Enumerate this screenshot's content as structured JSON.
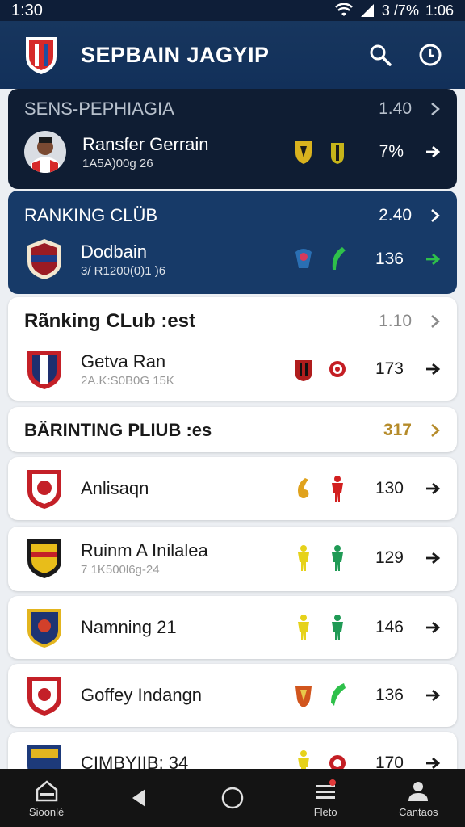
{
  "status_bar": {
    "time": "1:30",
    "battery": "3 /7%",
    "clock": "1:06"
  },
  "app_bar": {
    "title": "SEPBAIN JAGYIP"
  },
  "sections": [
    {
      "title": "SENS-PEPHIAGIA",
      "count": "1.40",
      "style": "dark",
      "row": {
        "name": "Ransfer Gerrain",
        "sub": "1A5A)00g 26",
        "value": "7%"
      }
    },
    {
      "title": "RANKING CLÜB",
      "count": "2.40",
      "style": "navy",
      "row": {
        "name": "Dodbain",
        "sub": "3/ R1200(0)1 )6",
        "value": "136"
      }
    },
    {
      "title": "Rãnking CLub :est",
      "count": "1.10",
      "style": "light",
      "row": {
        "name": "Getva Ran",
        "sub": "2A.K:S0B0G 15K",
        "value": "173"
      }
    },
    {
      "title": "BÄRINTING PLIUB :es",
      "count": "317",
      "style": "light"
    }
  ],
  "list_items": [
    {
      "name": "Anlisaqn",
      "sub": "",
      "value": "130"
    },
    {
      "name": "Ruinm A Inilalea",
      "sub": "7 1K500l6g-24",
      "value": "129"
    },
    {
      "name": "Namning 21",
      "sub": "",
      "value": "146"
    },
    {
      "name": "Goffey Indangn",
      "sub": "",
      "value": "136"
    },
    {
      "name": "CIMBYIIB: 34",
      "sub": "",
      "value": "170"
    }
  ],
  "bottom_nav": [
    {
      "label": "Sioonlé",
      "icon": "home-icon"
    },
    {
      "label": "",
      "icon": "back-icon"
    },
    {
      "label": "",
      "icon": "home-circle-icon"
    },
    {
      "label": "Fleto",
      "icon": "menu-icon"
    },
    {
      "label": "Cantaos",
      "icon": "profile-icon"
    }
  ],
  "colors": {
    "status_bar": "#0e1e38",
    "app_bar": "#17365e",
    "dark_card": "#0f1d33",
    "navy_card": "#173a68",
    "accent_gold": "#b58b2a",
    "accent_green": "#2ec04a"
  }
}
